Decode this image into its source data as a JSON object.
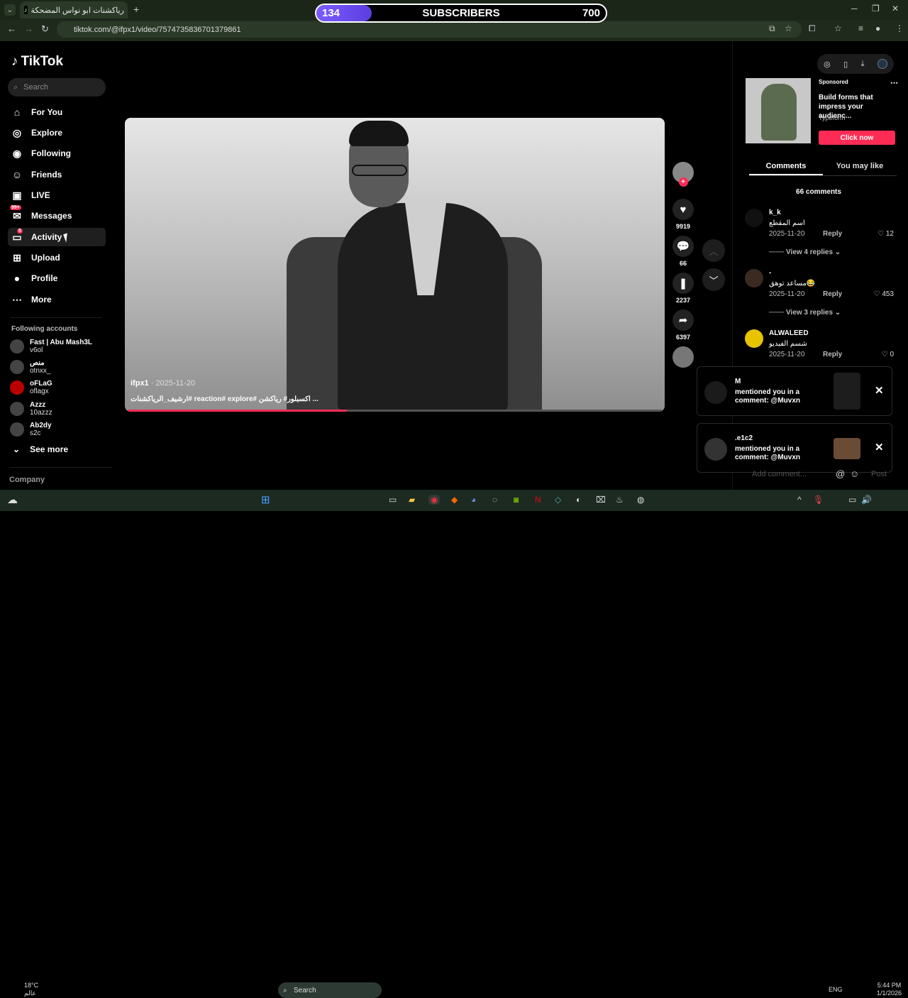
{
  "browser": {
    "tab_title": "رياكشنات ابو نواس المضحكة",
    "url": "tiktok.com/@ifpx1/video/7574735836701379861"
  },
  "overlay": {
    "sub_current": "134",
    "sub_label": "SUBSCRIBERS",
    "sub_goal": "700",
    "sub_progress": 0.19
  },
  "sidebar": {
    "logo": "TikTok",
    "search_placeholder": "Search",
    "nav": [
      {
        "label": "For You"
      },
      {
        "label": "Explore"
      },
      {
        "label": "Following"
      },
      {
        "label": "Friends"
      },
      {
        "label": "LIVE"
      },
      {
        "label": "Messages",
        "badge": "99+"
      },
      {
        "label": "Activity",
        "badge": "5"
      },
      {
        "label": "Upload"
      },
      {
        "label": "Profile"
      },
      {
        "label": "More"
      }
    ],
    "following_title": "Following accounts",
    "accounts": [
      {
        "name": "Fast | Abu Mash3L",
        "user": "v6ol"
      },
      {
        "name": "منص",
        "user": "otnxx_"
      },
      {
        "name": "oFLaG",
        "user": "oflagx"
      },
      {
        "name": "Azzz",
        "user": "10azzz"
      },
      {
        "name": "Ab2dy",
        "user": "s2c"
      }
    ],
    "see_more": "See more",
    "company": "Company"
  },
  "video": {
    "author": "ifpx1",
    "date": "2025-11-20",
    "caption": "ارشيف_الرياكشنات# reaction# explore# اكسبلور# رياكشن ...",
    "progress": 0.41
  },
  "actions": {
    "likes": "9919",
    "comments": "66",
    "saves": "2237",
    "shares": "6397"
  },
  "ad": {
    "sponsored": "Sponsored",
    "title": "Build forms that impress your audienc...",
    "brand": "Typeform",
    "cta": "Click now"
  },
  "panel": {
    "tab_comments": "Comments",
    "tab_like": "You may like",
    "count": "66 comments",
    "reply_label": "Reply",
    "comments": [
      {
        "user": "k_k",
        "text": "اسم المقطع",
        "date": "2025-11-20",
        "likes": "12",
        "replies": "View 4 replies"
      },
      {
        "user": "-",
        "text": "مساعد توهق😂",
        "date": "2025-11-20",
        "likes": "453",
        "replies": "View 3 replies"
      },
      {
        "user": "ALWALEED",
        "text": "شسم الفيديو",
        "date": "2025-11-20",
        "likes": "0"
      }
    ],
    "add_comment": "Add comment...",
    "post": "Post"
  },
  "toasts": [
    {
      "user": "M",
      "line1": "mentioned you in a",
      "line2": "comment: @Muvxn"
    },
    {
      "user": ".e1c2",
      "line1": "mentioned you in a",
      "line2": "comment: @Muvxn"
    }
  ],
  "taskbar": {
    "temp": "18°C",
    "weather_sub": "عالم",
    "search": "Search",
    "lang": "ENG",
    "time": "5:44 PM",
    "date": "1/1/2026"
  }
}
